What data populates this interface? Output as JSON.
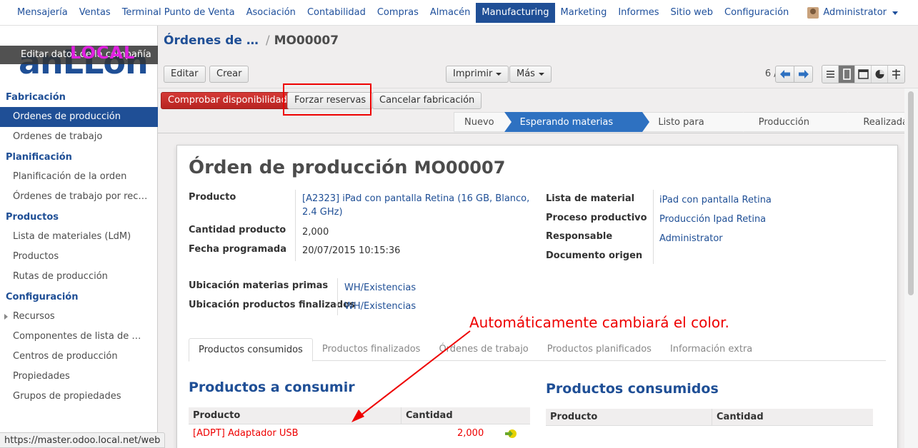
{
  "topmenu": {
    "items": [
      "Mensajería",
      "Ventas",
      "Terminal Punto de Venta",
      "Asociación",
      "Contabilidad",
      "Compras",
      "Almacén",
      "Manufacturing",
      "Marketing",
      "Informes",
      "Sitio web",
      "Configuración"
    ],
    "active": "Manufacturing",
    "user": "Administrator"
  },
  "logo": {
    "banner": "Editar datos de la compañía",
    "text": "anLLon",
    "env_tag": "LOCAL"
  },
  "sidebar": {
    "sections": [
      {
        "title": "Fabricación",
        "items": [
          "Ordenes de producción",
          "Ordenes de trabajo"
        ]
      },
      {
        "title": "Planificación",
        "items": [
          "Planificación de la orden",
          "Órdenes de trabajo por rec…"
        ]
      },
      {
        "title": "Productos",
        "items": [
          "Lista de materiales (LdM)",
          "Productos",
          "Rutas de producción"
        ]
      },
      {
        "title": "Configuración",
        "items": [
          "Recursos",
          "Componentes de lista de …",
          "Centros de producción",
          "Propiedades",
          "Grupos de propiedades"
        ]
      }
    ],
    "active_item": "Ordenes de producción"
  },
  "status_url": "https://master.odoo.local.net/web",
  "breadcrumb": {
    "parent": "Órdenes de …",
    "separator": "/",
    "current": "MO00007"
  },
  "toolbar": {
    "edit": "Editar",
    "create": "Crear",
    "print": "Imprimir",
    "more": "Más",
    "pager": "6 / 6"
  },
  "actions": {
    "check": "Comprobar disponibilidad",
    "force": "Forzar reservas",
    "cancel": "Cancelar fabricación"
  },
  "stages": [
    "Nuevo",
    "Esperando materias primas",
    "Listo para fabricar",
    "Producción iniciada",
    "Realizada"
  ],
  "current_stage": "Esperando materias primas",
  "form": {
    "title": "Órden de producción",
    "number": "MO00007",
    "left_fields": [
      {
        "label": "Producto",
        "value": "[A2323] iPad con pantalla Retina (16 GB, Blanco, 2.4 GHz)"
      },
      {
        "label": "Cantidad producto",
        "value": "2,000"
      },
      {
        "label": "Fecha programada",
        "value": "20/07/2015 10:15:36"
      }
    ],
    "right_fields": [
      {
        "label": "Lista de material",
        "value": "iPad con pantalla Retina"
      },
      {
        "label": "Proceso productivo",
        "value": "Producción Ipad Retina"
      },
      {
        "label": "Responsable",
        "value": "Administrator"
      },
      {
        "label": "Documento origen",
        "value": ""
      }
    ],
    "locations": [
      {
        "label": "Ubicación materias primas",
        "value": "WH/Existencias"
      },
      {
        "label": "Ubicación productos finalizados",
        "value": "WH/Existencias"
      }
    ]
  },
  "annotation": "Automáticamente cambiará el color.",
  "tabs": [
    "Productos consumidos",
    "Productos finalizados",
    "Órdenes de trabajo",
    "Productos planificados",
    "Información extra"
  ],
  "to_consume": {
    "title": "Productos a consumir",
    "headers": [
      "Producto",
      "Cantidad"
    ],
    "rows": [
      {
        "product": "[ADPT] Adaptador USB",
        "qty": "2,000"
      }
    ]
  },
  "consumed": {
    "title": "Productos consumidos",
    "headers": [
      "Producto",
      "Cantidad"
    ]
  },
  "colors": {
    "brand": "#1f4f96",
    "primary_button": "#c9302c",
    "stage_current": "#2e71c1",
    "annotation": "#e00000"
  }
}
